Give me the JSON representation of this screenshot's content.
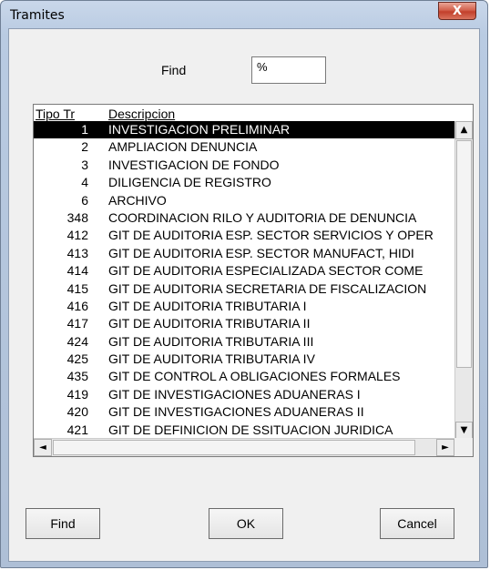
{
  "window": {
    "title": "Tramites",
    "close_glyph": "X"
  },
  "find": {
    "label": "Find",
    "value": "%"
  },
  "list": {
    "headers": {
      "tipo": "Tipo Tr",
      "descripcion": "Descripcion"
    },
    "rows": [
      {
        "num": "1",
        "desc": "INVESTIGACION PRELIMINAR"
      },
      {
        "num": "2",
        "desc": "AMPLIACION DENUNCIA"
      },
      {
        "num": "3",
        "desc": "INVESTIGACION DE FONDO"
      },
      {
        "num": "4",
        "desc": "DILIGENCIA DE REGISTRO"
      },
      {
        "num": "6",
        "desc": "ARCHIVO"
      },
      {
        "num": "348",
        "desc": "COORDINACION RILO Y AUDITORIA DE DENUNCIA"
      },
      {
        "num": "412",
        "desc": "GIT DE AUDITORIA ESP. SECTOR SERVICIOS Y OPER"
      },
      {
        "num": "413",
        "desc": "GIT DE AUDITORIA ESP. SECTOR MANUFACT, HIDI"
      },
      {
        "num": "414",
        "desc": "GIT DE AUDITORIA ESPECIALIZADA SECTOR COME"
      },
      {
        "num": "415",
        "desc": "GIT DE AUDITORIA SECRETARIA DE FISCALIZACION"
      },
      {
        "num": "416",
        "desc": "GIT DE AUDITORIA TRIBUTARIA I"
      },
      {
        "num": "417",
        "desc": "GIT DE AUDITORIA TRIBUTARIA II"
      },
      {
        "num": "424",
        "desc": "GIT DE AUDITORIA TRIBUTARIA III"
      },
      {
        "num": "425",
        "desc": "GIT DE AUDITORIA TRIBUTARIA IV"
      },
      {
        "num": "435",
        "desc": "GIT DE CONTROL A OBLIGACIONES FORMALES"
      },
      {
        "num": "419",
        "desc": "GIT DE INVESTIGACIONES ADUANERAS I"
      },
      {
        "num": "420",
        "desc": "GIT DE INVESTIGACIONES ADUANERAS II"
      },
      {
        "num": "421",
        "desc": "GIT DE DEFINICION DE SSITUACION JURIDICA"
      }
    ],
    "selected_index": 0,
    "scroll_glyphs": {
      "up": "▲",
      "down": "▼",
      "left": "◄",
      "right": "►"
    }
  },
  "buttons": {
    "find": "Find",
    "ok": "OK",
    "cancel": "Cancel"
  }
}
